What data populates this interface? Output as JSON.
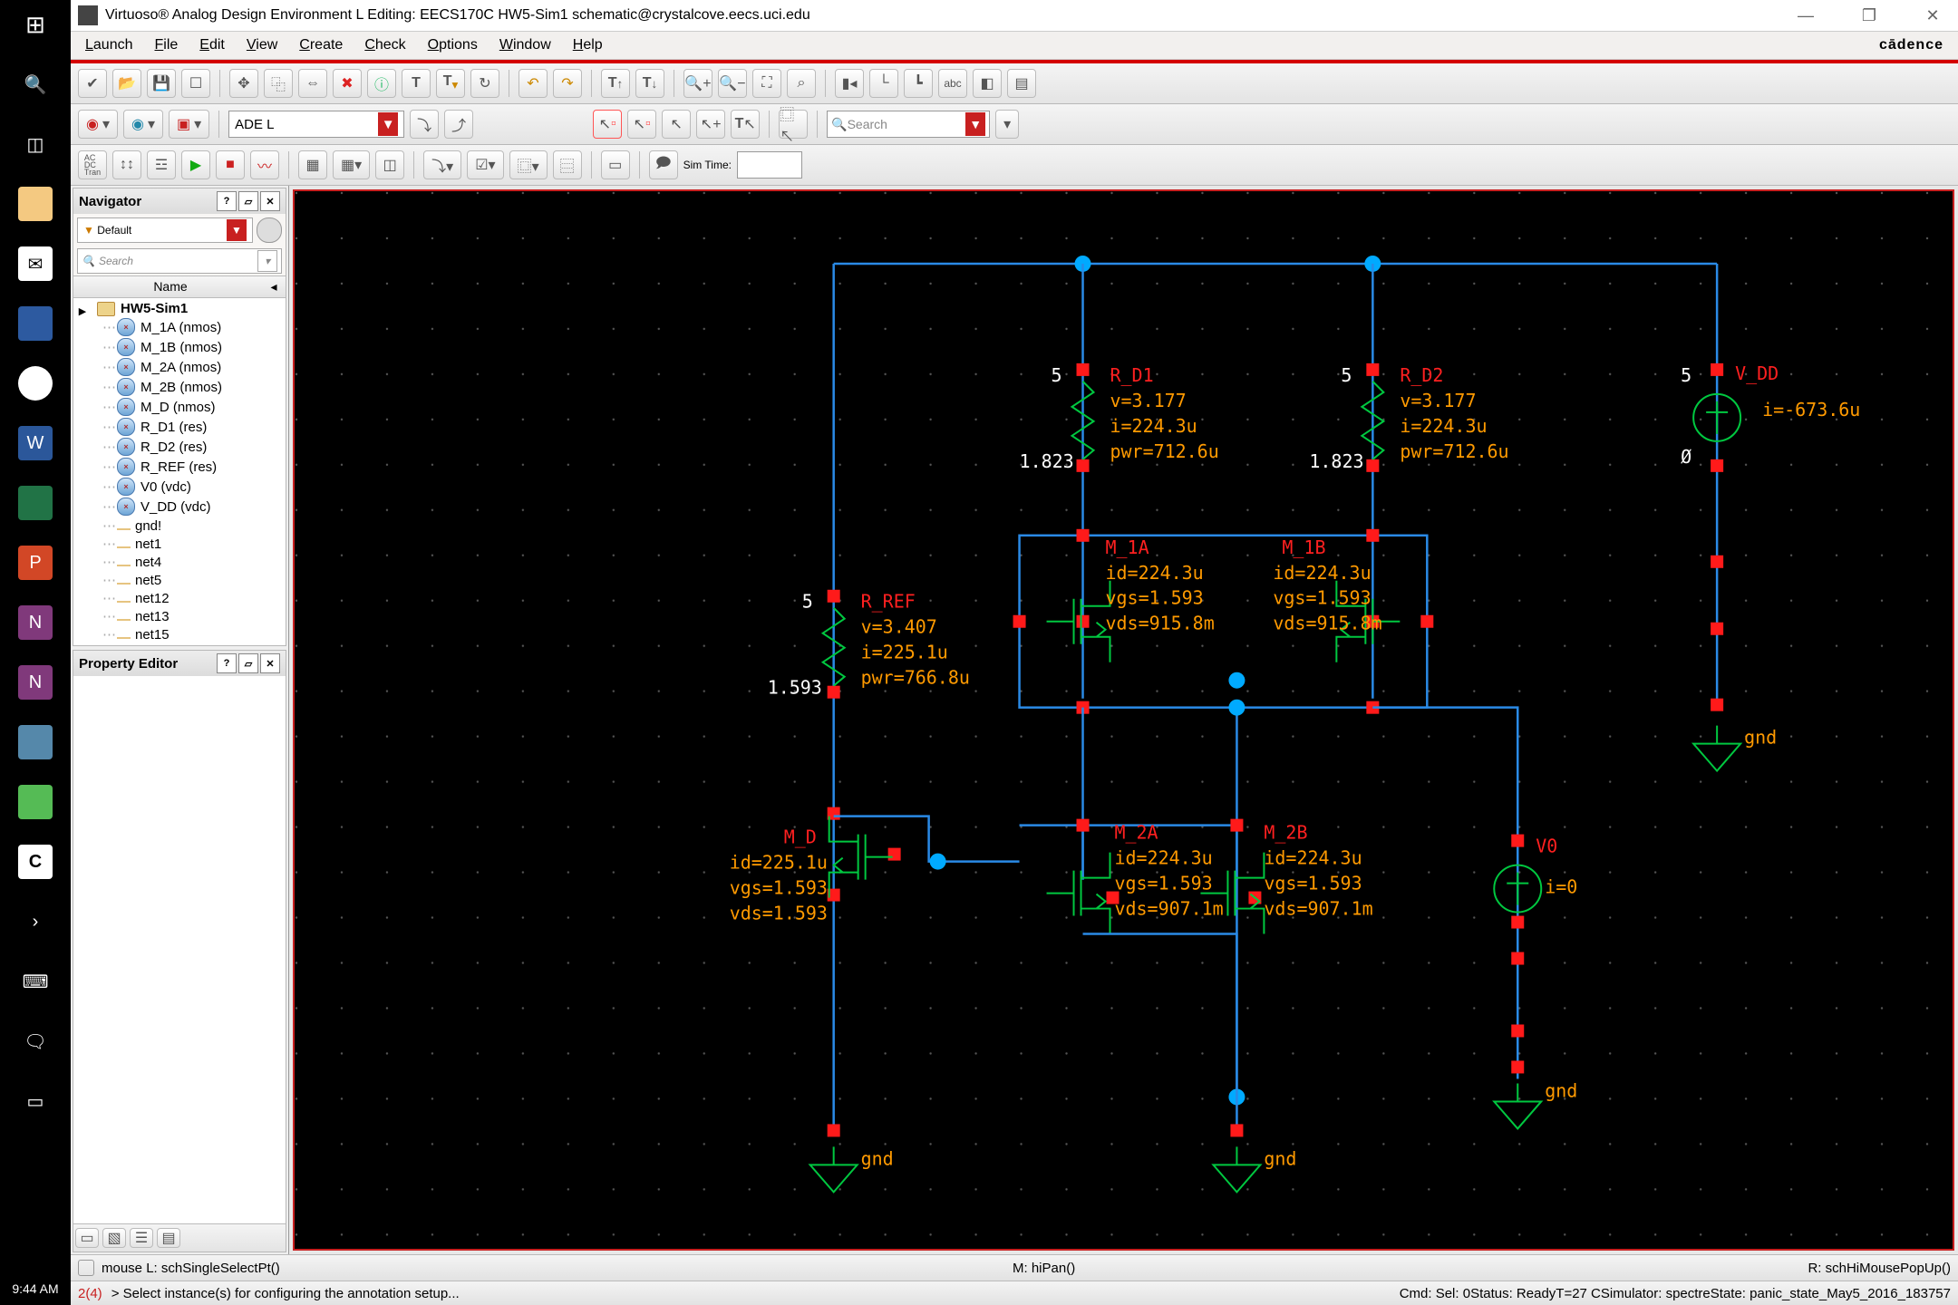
{
  "os": {
    "clock": "9:44 AM"
  },
  "window": {
    "title": "Virtuoso® Analog Design Environment L Editing: EECS170C HW5-Sim1 schematic@crystalcove.eecs.uci.edu",
    "brand": "cādence"
  },
  "menu": {
    "items": [
      "Launch",
      "File",
      "Edit",
      "View",
      "Create",
      "Check",
      "Options",
      "Window",
      "Help"
    ]
  },
  "toolbar2": {
    "ade_label": "ADE L",
    "search_placeholder": "Search"
  },
  "toolbar3": {
    "sim_time_label": "Sim Time:"
  },
  "navigator": {
    "title": "Navigator",
    "filter_label": "Default",
    "filter_icon": "▼",
    "search_placeholder": "Search",
    "col_header": "Name",
    "root": "HW5-Sim1",
    "items": [
      {
        "name": "M_1A (nmos)",
        "icon": "circle"
      },
      {
        "name": "M_1B (nmos)",
        "icon": "circle"
      },
      {
        "name": "M_2A (nmos)",
        "icon": "circle"
      },
      {
        "name": "M_2B (nmos)",
        "icon": "circle"
      },
      {
        "name": "M_D (nmos)",
        "icon": "circle"
      },
      {
        "name": "R_D1 (res)",
        "icon": "circle"
      },
      {
        "name": "R_D2 (res)",
        "icon": "circle"
      },
      {
        "name": "R_REF (res)",
        "icon": "circle"
      },
      {
        "name": "V0 (vdc)",
        "icon": "circle"
      },
      {
        "name": "V_DD (vdc)",
        "icon": "circle"
      },
      {
        "name": "gnd!",
        "icon": "net"
      },
      {
        "name": "net1",
        "icon": "net"
      },
      {
        "name": "net4",
        "icon": "net"
      },
      {
        "name": "net5",
        "icon": "net"
      },
      {
        "name": "net12",
        "icon": "net"
      },
      {
        "name": "net13",
        "icon": "net"
      },
      {
        "name": "net15",
        "icon": "net"
      }
    ]
  },
  "property_editor": {
    "title": "Property Editor"
  },
  "status_line1": {
    "mouseL": "mouse L: schSingleSelectPt()",
    "mouseM": "M: hiPan()",
    "mouseR": "R: schHiMousePopUp()"
  },
  "status_line2": {
    "count": "2(4)",
    "prompt": "> Select instance(s) for configuring the annotation setup...",
    "cmd": "Cmd: Sel: 0",
    "status": "Status: Ready",
    "temp": "T=27   C",
    "simulator": "Simulator: spectre",
    "state": "State: panic_state_May5_2016_183757"
  },
  "schematic": {
    "R_D1": {
      "name": "R_D1",
      "top": "5",
      "bot": "1.823",
      "lines": [
        "v=3.177",
        "i=224.3u",
        "pwr=712.6u"
      ]
    },
    "R_D2": {
      "name": "R_D2",
      "top": "5",
      "bot": "1.823",
      "lines": [
        "v=3.177",
        "i=224.3u",
        "pwr=712.6u"
      ]
    },
    "R_REF": {
      "name": "R_REF",
      "top": "5",
      "bot": "1.593",
      "lines": [
        "v=3.407",
        "i=225.1u",
        "pwr=766.8u"
      ]
    },
    "V_DD": {
      "name": "V_DD",
      "top": "5",
      "zero": "Ø",
      "lines": [
        "i=-673.6u"
      ]
    },
    "V0": {
      "name": "V0",
      "lines": [
        "i=0"
      ]
    },
    "M_1A": {
      "name": "M_1A",
      "lines": [
        "id=224.3u",
        "vgs=1.593",
        "vds=915.8m"
      ]
    },
    "M_1B": {
      "name": "M_1B",
      "lines": [
        "id=224.3u",
        "vgs=1.593",
        "vds=915.8m"
      ]
    },
    "M_2A": {
      "name": "M_2A",
      "lines": [
        "id=224.3u",
        "vgs=1.593",
        "vds=907.1m"
      ]
    },
    "M_2B": {
      "name": "M_2B",
      "lines": [
        "id=224.3u",
        "vgs=1.593",
        "vds=907.1m"
      ]
    },
    "M_D": {
      "name": "M_D",
      "lines": [
        "id=225.1u",
        "vgs=1.593",
        "vds=1.593"
      ]
    },
    "gnd_label": "gnd"
  }
}
